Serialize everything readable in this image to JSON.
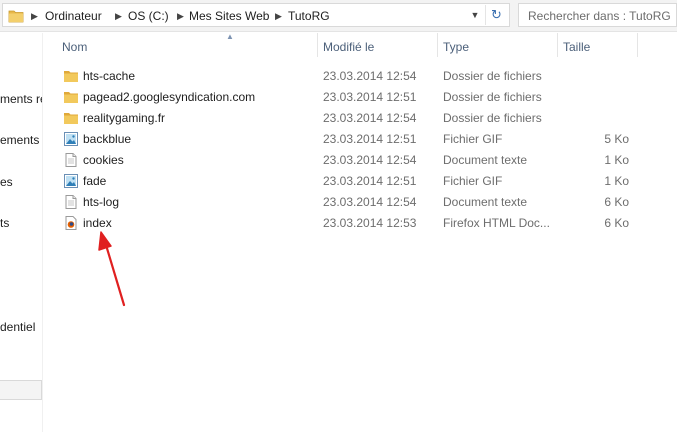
{
  "breadcrumb": {
    "items": [
      "Ordinateur",
      "OS (C:)",
      "Mes Sites Web",
      "TutoRG"
    ]
  },
  "search": {
    "placeholder": "Rechercher dans : TutoRG"
  },
  "nav": {
    "items": [
      "ments réc",
      "ements",
      "es",
      "ts",
      "dentiel"
    ]
  },
  "columns": {
    "name": "Nom",
    "modified": "Modifié le",
    "type": "Type",
    "size": "Taille"
  },
  "files": [
    {
      "name": "hts-cache",
      "date": "23.03.2014 12:54",
      "type": "Dossier de fichiers",
      "size": "",
      "icon": "folder-icon"
    },
    {
      "name": "pagead2.googlesyndication.com",
      "date": "23.03.2014 12:51",
      "type": "Dossier de fichiers",
      "size": "",
      "icon": "folder-icon"
    },
    {
      "name": "realitygaming.fr",
      "date": "23.03.2014 12:54",
      "type": "Dossier de fichiers",
      "size": "",
      "icon": "folder-icon"
    },
    {
      "name": "backblue",
      "date": "23.03.2014 12:51",
      "type": "Fichier GIF",
      "size": "5 Ko",
      "icon": "image-file-icon"
    },
    {
      "name": "cookies",
      "date": "23.03.2014 12:54",
      "type": "Document texte",
      "size": "1 Ko",
      "icon": "text-file-icon"
    },
    {
      "name": "fade",
      "date": "23.03.2014 12:51",
      "type": "Fichier GIF",
      "size": "1 Ko",
      "icon": "image-file-icon"
    },
    {
      "name": "hts-log",
      "date": "23.03.2014 12:54",
      "type": "Document texte",
      "size": "6 Ko",
      "icon": "text-file-icon"
    },
    {
      "name": "index",
      "date": "23.03.2014 12:53",
      "type": "Firefox HTML Doc...",
      "size": "6 Ko",
      "icon": "firefox-html-icon"
    }
  ],
  "colors": {
    "header_text": "#4c607a",
    "folder": "#e8b84a",
    "arrow": "#e02020",
    "meta_text": "#6d6d6d"
  }
}
